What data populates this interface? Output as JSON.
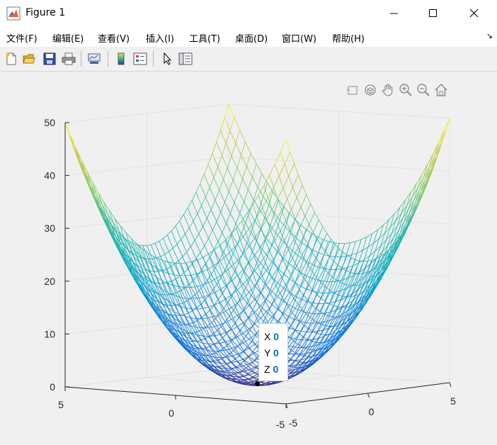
{
  "window": {
    "title": "Figure 1"
  },
  "menu": {
    "items": [
      "文件(F)",
      "编辑(E)",
      "查看(V)",
      "插入(I)",
      "工具(T)",
      "桌面(D)",
      "窗口(W)",
      "帮助(H)"
    ]
  },
  "toolbar": {
    "buttons": [
      "new-figure-icon",
      "open-file-icon",
      "save-icon",
      "print-icon",
      "link-plot-icon",
      "colorbar-icon",
      "legend-icon",
      "pointer-icon",
      "property-inspector-icon"
    ]
  },
  "axes_toolbar": {
    "buttons": [
      "brush-icon",
      "rotate-3d-icon",
      "pan-icon",
      "zoom-in-icon",
      "zoom-out-icon",
      "home-icon"
    ]
  },
  "chart_data": {
    "type": "surface-mesh",
    "function": "z = x^2 + y^2",
    "x_range": [
      -5,
      5
    ],
    "y_range": [
      -5,
      5
    ],
    "zlim": [
      0,
      50
    ],
    "z_ticks": [
      "0",
      "10",
      "20",
      "30",
      "40",
      "50"
    ],
    "x_ticks": [
      "-5",
      "0",
      "5"
    ],
    "y_ticks": [
      "-5",
      "0",
      "5"
    ],
    "colormap": "parula",
    "grid": true
  },
  "datatip": {
    "x_label": "X",
    "x_value": "0",
    "y_label": "Y",
    "y_value": "0",
    "z_label": "Z",
    "z_value": "0"
  }
}
